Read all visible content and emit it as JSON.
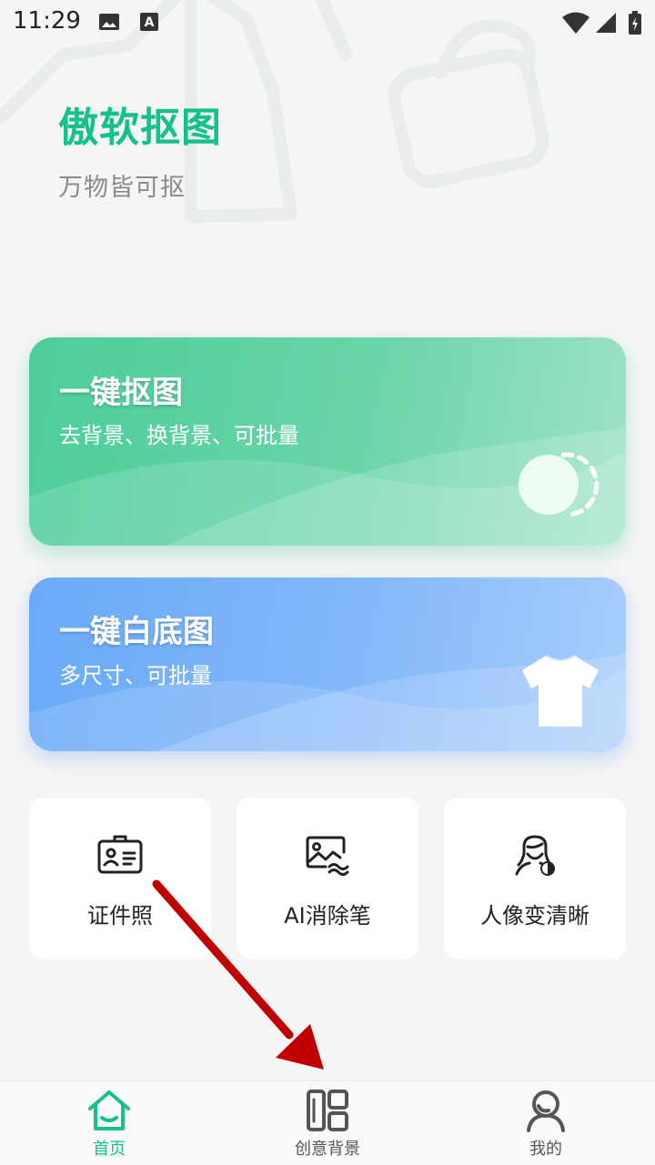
{
  "status_bar": {
    "time": "11:29",
    "icons": [
      "image-icon",
      "a-letter-icon",
      "wifi-icon",
      "signal-icon",
      "battery-icon"
    ]
  },
  "header": {
    "title": "傲软抠图",
    "subtitle": "万物皆可抠"
  },
  "cards": [
    {
      "title": "一键抠图",
      "subtitle": "去背景、换背景、可批量",
      "icon": "cutout-circle-icon"
    },
    {
      "title": "一键白底图",
      "subtitle": "多尺寸、可批量",
      "icon": "tshirt-icon"
    }
  ],
  "tools": [
    {
      "label": "证件照",
      "icon": "id-card-icon"
    },
    {
      "label": "AI消除笔",
      "icon": "image-eraser-icon"
    },
    {
      "label": "人像变清晰",
      "icon": "portrait-enhance-icon"
    }
  ],
  "tabbar": {
    "tabs": [
      {
        "label": "首页",
        "icon": "home-icon",
        "active": true
      },
      {
        "label": "创意背景",
        "icon": "layout-icon",
        "active": false
      },
      {
        "label": "我的",
        "icon": "user-icon",
        "active": false
      }
    ]
  },
  "colors": {
    "brand": "#14c08c",
    "card_green": "#4dcd9a",
    "card_blue": "#6aaaf8",
    "arrow": "#c00000"
  }
}
